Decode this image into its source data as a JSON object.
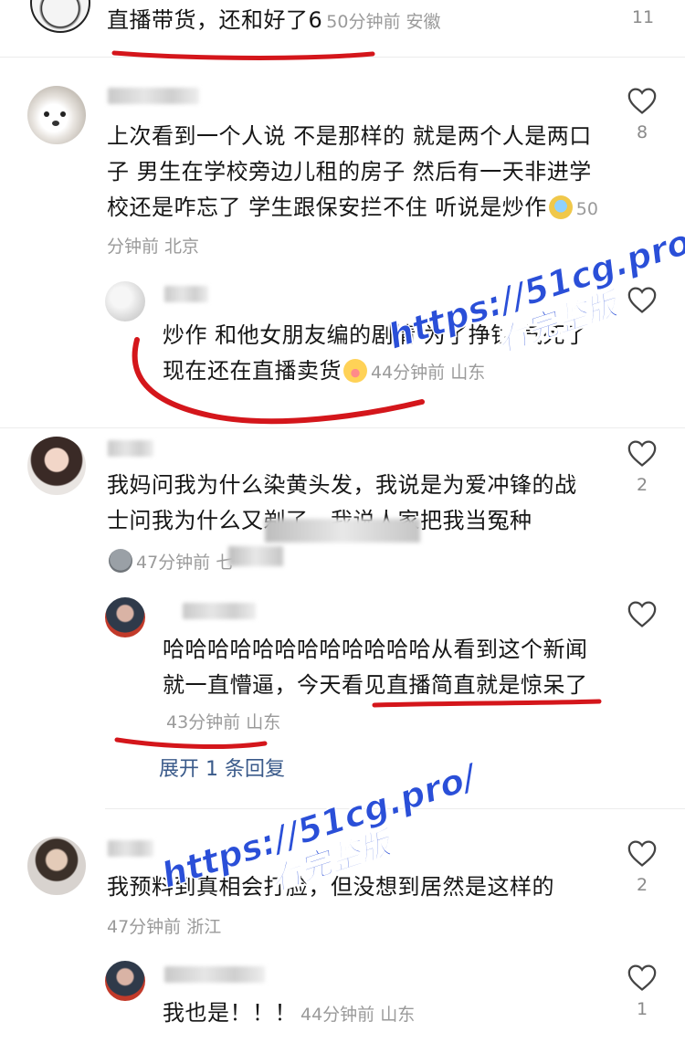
{
  "comments": [
    {
      "text": "直播带货，还和好了6",
      "meta": "50分钟前 安徽",
      "likes": "11"
    },
    {
      "text": "上次看到一个人说 不是那样的 就是两个人是两口子 男生在学校旁边儿租的房子 然后有一天非进学校还是咋忘了 学生跟保安拦不住 听说是炒作",
      "meta": "50分钟前 北京",
      "likes": "8",
      "reply": {
        "text": "炒作 和他女朋友编的剧情  为了挣钱 气死了 现在还在直播卖货",
        "meta": "44分钟前 山东"
      }
    },
    {
      "text": "我妈问我为什么染黄头发，我说是为爱冲锋的战士问我为什么又剃了，我说人家把我当冤种",
      "meta": "47分钟前 七",
      "likes": "2",
      "reply": {
        "text": "哈哈哈哈哈哈哈哈哈哈哈哈从看到这个新闻就一直懵逼，今天看见直播简直就是惊呆了",
        "meta": "43分钟前 山东",
        "expand": "展开 1 条回复"
      }
    },
    {
      "text": "我预料到真相会打脸，但没想到居然是这样的",
      "meta": "47分钟前 浙江",
      "likes": "2",
      "reply": {
        "text": "我也是！！！",
        "meta": "44分钟前 山东",
        "likes": "1"
      }
    }
  ],
  "watermark": {
    "url": "https://51cg.pro/",
    "sub": "看完整版"
  },
  "colors": {
    "annotation_red": "#d4161b",
    "watermark_blue": "#2a4fd8",
    "meta_gray": "#9a9a9a"
  },
  "icons": [
    "heart-outline-icon",
    "avatar"
  ]
}
